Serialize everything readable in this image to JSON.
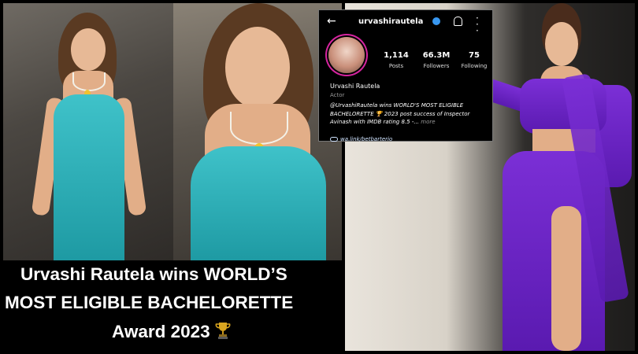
{
  "instagram": {
    "username": "urvashirautela",
    "stats": [
      {
        "value": "1,114",
        "label": "Posts"
      },
      {
        "value": "66.3M",
        "label": "Followers"
      },
      {
        "value": "75",
        "label": "Following"
      }
    ],
    "display_name": "Urvashi Rautela",
    "category": "Actor",
    "bio": "@UrvashiRautela wins WORLD'S MOST ELIGIBLE BACHELORETTE 🏆 2023  post success of Inspector Avinash with IMDB rating 8.5 -...",
    "more_label": "more",
    "link": "wa.link/betbarterio"
  },
  "headline": {
    "line1": "Urvashi Rautela wins WORLD’S",
    "line2": "MOST ELIGIBLE BACHELORETTE",
    "line3": "Award 2023"
  },
  "colors": {
    "teal_dress": "#1e9aa3",
    "purple_outfit": "#6a22c4",
    "verified_badge": "#3897f0"
  }
}
